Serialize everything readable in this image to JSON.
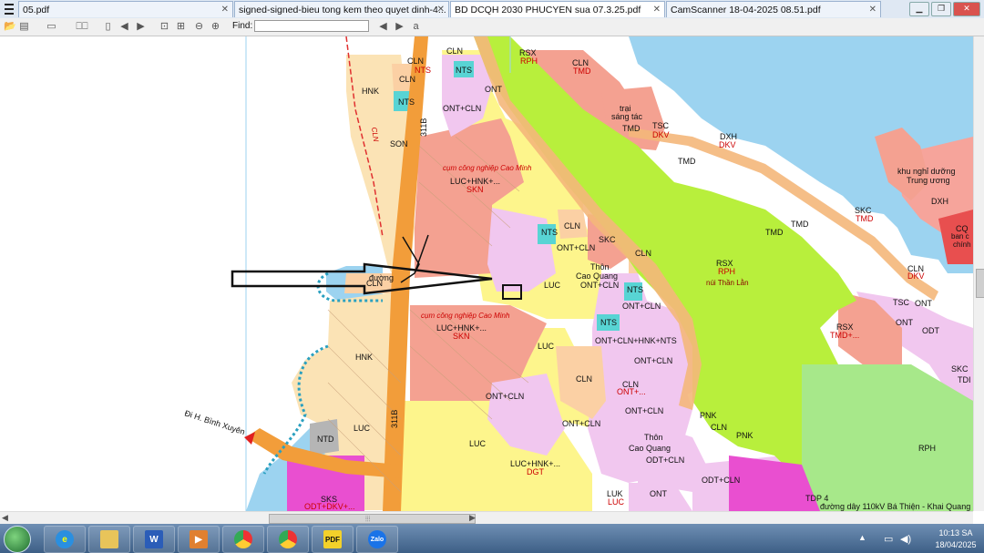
{
  "tabs": [
    {
      "label": "05.pdf"
    },
    {
      "label": "signed-signed-bieu tong kem theo quyet dinh-4..."
    },
    {
      "label": "BD DCQH 2030 PHUCYEN sua 07.3.25.pdf"
    },
    {
      "label": "CamScanner 18-04-2025 08.51.pdf"
    }
  ],
  "toolbar": {
    "find_label": "Find:",
    "find_value": ""
  },
  "map": {
    "labels": [
      {
        "t": "CLN"
      },
      {
        "t": "NTS"
      },
      {
        "t": "CLN"
      },
      {
        "t": "NTS"
      },
      {
        "t": "HNK"
      },
      {
        "t": "CLN"
      },
      {
        "t": "NTS"
      },
      {
        "t": "ONT+CLN"
      },
      {
        "t": "ONT"
      },
      {
        "t": "SON"
      },
      {
        "t": "311B"
      },
      {
        "t": "RSX"
      },
      {
        "t": "RPH"
      },
      {
        "t": "CLN"
      },
      {
        "t": "TMD"
      },
      {
        "t": "trại"
      },
      {
        "t": "sáng tác"
      },
      {
        "t": "TMD"
      },
      {
        "t": "TSC"
      },
      {
        "t": "DKV"
      },
      {
        "t": "DXH"
      },
      {
        "t": "DKV"
      },
      {
        "t": "TMD"
      },
      {
        "t": "khu nghỉ dưỡng"
      },
      {
        "t": "Trung ương"
      },
      {
        "t": "DXH"
      },
      {
        "t": "cụm công nghiệp Cao Minh"
      },
      {
        "t": "LUC+HNK+..."
      },
      {
        "t": "SKN"
      },
      {
        "t": "SKC"
      },
      {
        "t": "TMD"
      },
      {
        "t": "TMD"
      },
      {
        "t": "TMD"
      },
      {
        "t": "CQ"
      },
      {
        "t": "ban c"
      },
      {
        "t": "chính"
      },
      {
        "t": "CLN"
      },
      {
        "t": "NTS"
      },
      {
        "t": "ONT+CLN"
      },
      {
        "t": "SKC"
      },
      {
        "t": "CLN"
      },
      {
        "t": "Thôn"
      },
      {
        "t": "Cao Quang"
      },
      {
        "t": "ONT+CLN"
      },
      {
        "t": "RSX"
      },
      {
        "t": "RPH"
      },
      {
        "t": "núi Thần Lằn"
      },
      {
        "t": "CLN"
      },
      {
        "t": "DKV"
      },
      {
        "t": "TSC"
      },
      {
        "t": "ONT"
      },
      {
        "t": "CLN"
      },
      {
        "t": "LUC"
      },
      {
        "t": "NTS"
      },
      {
        "t": "ONT+CLN"
      },
      {
        "t": "cụm công nghiệp Cao Minh"
      },
      {
        "t": "LUC+HNK+..."
      },
      {
        "t": "SKN"
      },
      {
        "t": "NTS"
      },
      {
        "t": "ONT+CLN+HNK+NTS"
      },
      {
        "t": "RSX"
      },
      {
        "t": "TMD+..."
      },
      {
        "t": "ONT"
      },
      {
        "t": "ODT"
      },
      {
        "t": "SKC"
      },
      {
        "t": "TDI"
      },
      {
        "t": "HNK"
      },
      {
        "t": "LUC"
      },
      {
        "t": "ONT+CLN"
      },
      {
        "t": "CLN"
      },
      {
        "t": "ONT+CLN"
      },
      {
        "t": "CLN"
      },
      {
        "t": "ONT+..."
      },
      {
        "t": "ONT+CLN"
      },
      {
        "t": "311B"
      },
      {
        "t": "Đi H. Bình Xuyên"
      },
      {
        "t": "PNK"
      },
      {
        "t": "CLN"
      },
      {
        "t": "PNK"
      },
      {
        "t": "Thôn"
      },
      {
        "t": "Cao Quang"
      },
      {
        "t": "ONT+CLN"
      },
      {
        "t": "RPH"
      },
      {
        "t": "NTD"
      },
      {
        "t": "LUC"
      },
      {
        "t": "LUC"
      },
      {
        "t": "LUC+HNK+..."
      },
      {
        "t": "DGT"
      },
      {
        "t": "ODT+CLN"
      },
      {
        "t": "SKS"
      },
      {
        "t": "ODT+DKV+..."
      },
      {
        "t": "LUK"
      },
      {
        "t": "LUC"
      },
      {
        "t": "ONT"
      },
      {
        "t": "ODT+CLN"
      },
      {
        "t": "TDP 4"
      },
      {
        "t": "đường dây 110kV Bá Thiện - Khai Quang"
      },
      {
        "t": "CLN"
      },
      {
        "t": "đường"
      }
    ]
  },
  "taskbar": {
    "apps": [
      {
        "name": "ie",
        "label": "e"
      },
      {
        "name": "explorer",
        "label": ""
      },
      {
        "name": "word",
        "label": "W"
      },
      {
        "name": "media",
        "label": "▶"
      },
      {
        "name": "chrome1",
        "label": ""
      },
      {
        "name": "chrome2",
        "label": ""
      },
      {
        "name": "pdf",
        "label": "PDF"
      },
      {
        "name": "zalo",
        "label": "Zalo"
      }
    ],
    "time": "10:13 SA",
    "date": "18/04/2025"
  }
}
